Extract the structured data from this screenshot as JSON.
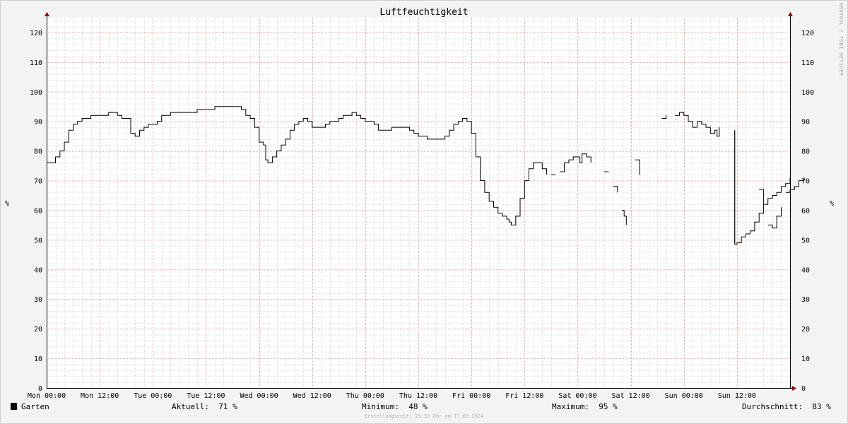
{
  "chart_data": {
    "type": "line",
    "title": "Luftfeuchtigkeit",
    "ylabel": "%",
    "ylim": [
      0,
      125
    ],
    "y_ticks": [
      0,
      10,
      20,
      30,
      40,
      50,
      60,
      70,
      80,
      90,
      100,
      110,
      120
    ],
    "x_ticks": [
      "Mon 00:00",
      "Mon 12:00",
      "Tue 00:00",
      "Tue 12:00",
      "Wed 00:00",
      "Wed 12:00",
      "Thu 00:00",
      "Thu 12:00",
      "Fri 00:00",
      "Fri 12:00",
      "Sat 00:00",
      "Sat 12:00",
      "Sun 00:00",
      "Sun 12:00"
    ],
    "x_unit": "hours since Mon 00:00",
    "xlim": [
      0,
      168
    ],
    "grid": true,
    "line_color": "#000000",
    "series": [
      {
        "name": "Garten",
        "segments": [
          [
            [
              0,
              76
            ],
            [
              1,
              76
            ],
            [
              2,
              78
            ],
            [
              3,
              80
            ],
            [
              4,
              83
            ],
            [
              5,
              87
            ],
            [
              6,
              89
            ],
            [
              7,
              90
            ],
            [
              8,
              91
            ],
            [
              9,
              91
            ],
            [
              10,
              92
            ],
            [
              12,
              92
            ],
            [
              13,
              92
            ],
            [
              14,
              93
            ],
            [
              15,
              93
            ],
            [
              16,
              92
            ],
            [
              17,
              91
            ],
            [
              18,
              91
            ],
            [
              19,
              86
            ],
            [
              20,
              85
            ],
            [
              21,
              87
            ],
            [
              22,
              88
            ],
            [
              23,
              89
            ],
            [
              24,
              89
            ],
            [
              25,
              90
            ],
            [
              26,
              92
            ],
            [
              28,
              93
            ],
            [
              31,
              93
            ],
            [
              33,
              93
            ],
            [
              34,
              94
            ],
            [
              36,
              94
            ],
            [
              38,
              95
            ],
            [
              41,
              95
            ],
            [
              43,
              95
            ],
            [
              44,
              94
            ],
            [
              45,
              92
            ],
            [
              46,
              91
            ],
            [
              47,
              88
            ],
            [
              48,
              83
            ],
            [
              49,
              82
            ],
            [
              49.5,
              77
            ],
            [
              50,
              76
            ],
            [
              51,
              78
            ],
            [
              52,
              80
            ],
            [
              53,
              82
            ],
            [
              54,
              84
            ],
            [
              55,
              87
            ],
            [
              56,
              89
            ],
            [
              57,
              90
            ],
            [
              58,
              91
            ],
            [
              59,
              90
            ],
            [
              60,
              88
            ],
            [
              62,
              88
            ],
            [
              63,
              89
            ],
            [
              64,
              90
            ],
            [
              66,
              91
            ],
            [
              67,
              92
            ],
            [
              69,
              93
            ],
            [
              70,
              92
            ],
            [
              71,
              91
            ],
            [
              72,
              90
            ],
            [
              73,
              90
            ],
            [
              74,
              89
            ],
            [
              75,
              87
            ],
            [
              76,
              87
            ],
            [
              77,
              87
            ],
            [
              78,
              88
            ],
            [
              80,
              88
            ],
            [
              81,
              88
            ],
            [
              82,
              87
            ],
            [
              83,
              86
            ],
            [
              84,
              85
            ],
            [
              86,
              84
            ],
            [
              87,
              84
            ],
            [
              88,
              84
            ],
            [
              89,
              84
            ],
            [
              90,
              85
            ],
            [
              91,
              87
            ],
            [
              92,
              89
            ],
            [
              93,
              90
            ],
            [
              94,
              91
            ],
            [
              95,
              90
            ],
            [
              96,
              86
            ],
            [
              97,
              78
            ],
            [
              98,
              70
            ],
            [
              99,
              66
            ],
            [
              100,
              63
            ],
            [
              101,
              61
            ],
            [
              102,
              59
            ],
            [
              103,
              58
            ],
            [
              104,
              57
            ],
            [
              104.5,
              56
            ],
            [
              105,
              55
            ],
            [
              106,
              58
            ],
            [
              107,
              64
            ],
            [
              108,
              70
            ],
            [
              109,
              74
            ],
            [
              110,
              76
            ],
            [
              111,
              76
            ],
            [
              112,
              74
            ],
            [
              113,
              72
            ]
          ],
          [
            [
              114,
              72
            ],
            [
              115,
              72
            ]
          ],
          [
            [
              116,
              73
            ],
            [
              117,
              76
            ],
            [
              118,
              77
            ],
            [
              119,
              78
            ],
            [
              120,
              78
            ],
            [
              120.5,
              76
            ],
            [
              121,
              79
            ],
            [
              122,
              78
            ],
            [
              123,
              76
            ]
          ],
          [
            [
              126,
              73
            ],
            [
              127,
              73
            ]
          ],
          [
            [
              128,
              68
            ],
            [
              129,
              66
            ]
          ],
          [
            [
              130,
              60
            ],
            [
              130.5,
              58
            ],
            [
              131,
              55
            ]
          ],
          [
            [
              133,
              77
            ],
            [
              134,
              72
            ]
          ],
          [
            [
              139,
              91
            ],
            [
              140,
              92
            ]
          ],
          [
            [
              142,
              92
            ],
            [
              143,
              93
            ],
            [
              144,
              92
            ],
            [
              145,
              90
            ],
            [
              146,
              88
            ],
            [
              147,
              90
            ],
            [
              148,
              89
            ],
            [
              149,
              88
            ],
            [
              150,
              86
            ],
            [
              151,
              87
            ],
            [
              151.5,
              85
            ],
            [
              152,
              88
            ]
          ],
          [
            [
              161,
              67
            ],
            [
              162,
              62
            ]
          ],
          [
            [
              163,
              55
            ],
            [
              164,
              54
            ],
            [
              165,
              58
            ],
            [
              166,
              61
            ]
          ],
          [
            [
              167,
              66
            ],
            [
              168,
              67
            ],
            [
              169,
              68
            ],
            [
              170,
              70
            ],
            [
              171,
              71
            ]
          ]
        ]
      }
    ]
  },
  "legend": {
    "label": "Garten",
    "aktuell": "Aktuell:  71 %",
    "minimum": "Minimum:  48 %",
    "maximum": "Maximum:  95 %",
    "durchschnitt": "Durchschnitt:  83 %"
  },
  "footer": "Erstellungszeit: 23:55 Uhr am 17.03.2024",
  "watermark": "RRDTOOL / TOBI OETIKER"
}
